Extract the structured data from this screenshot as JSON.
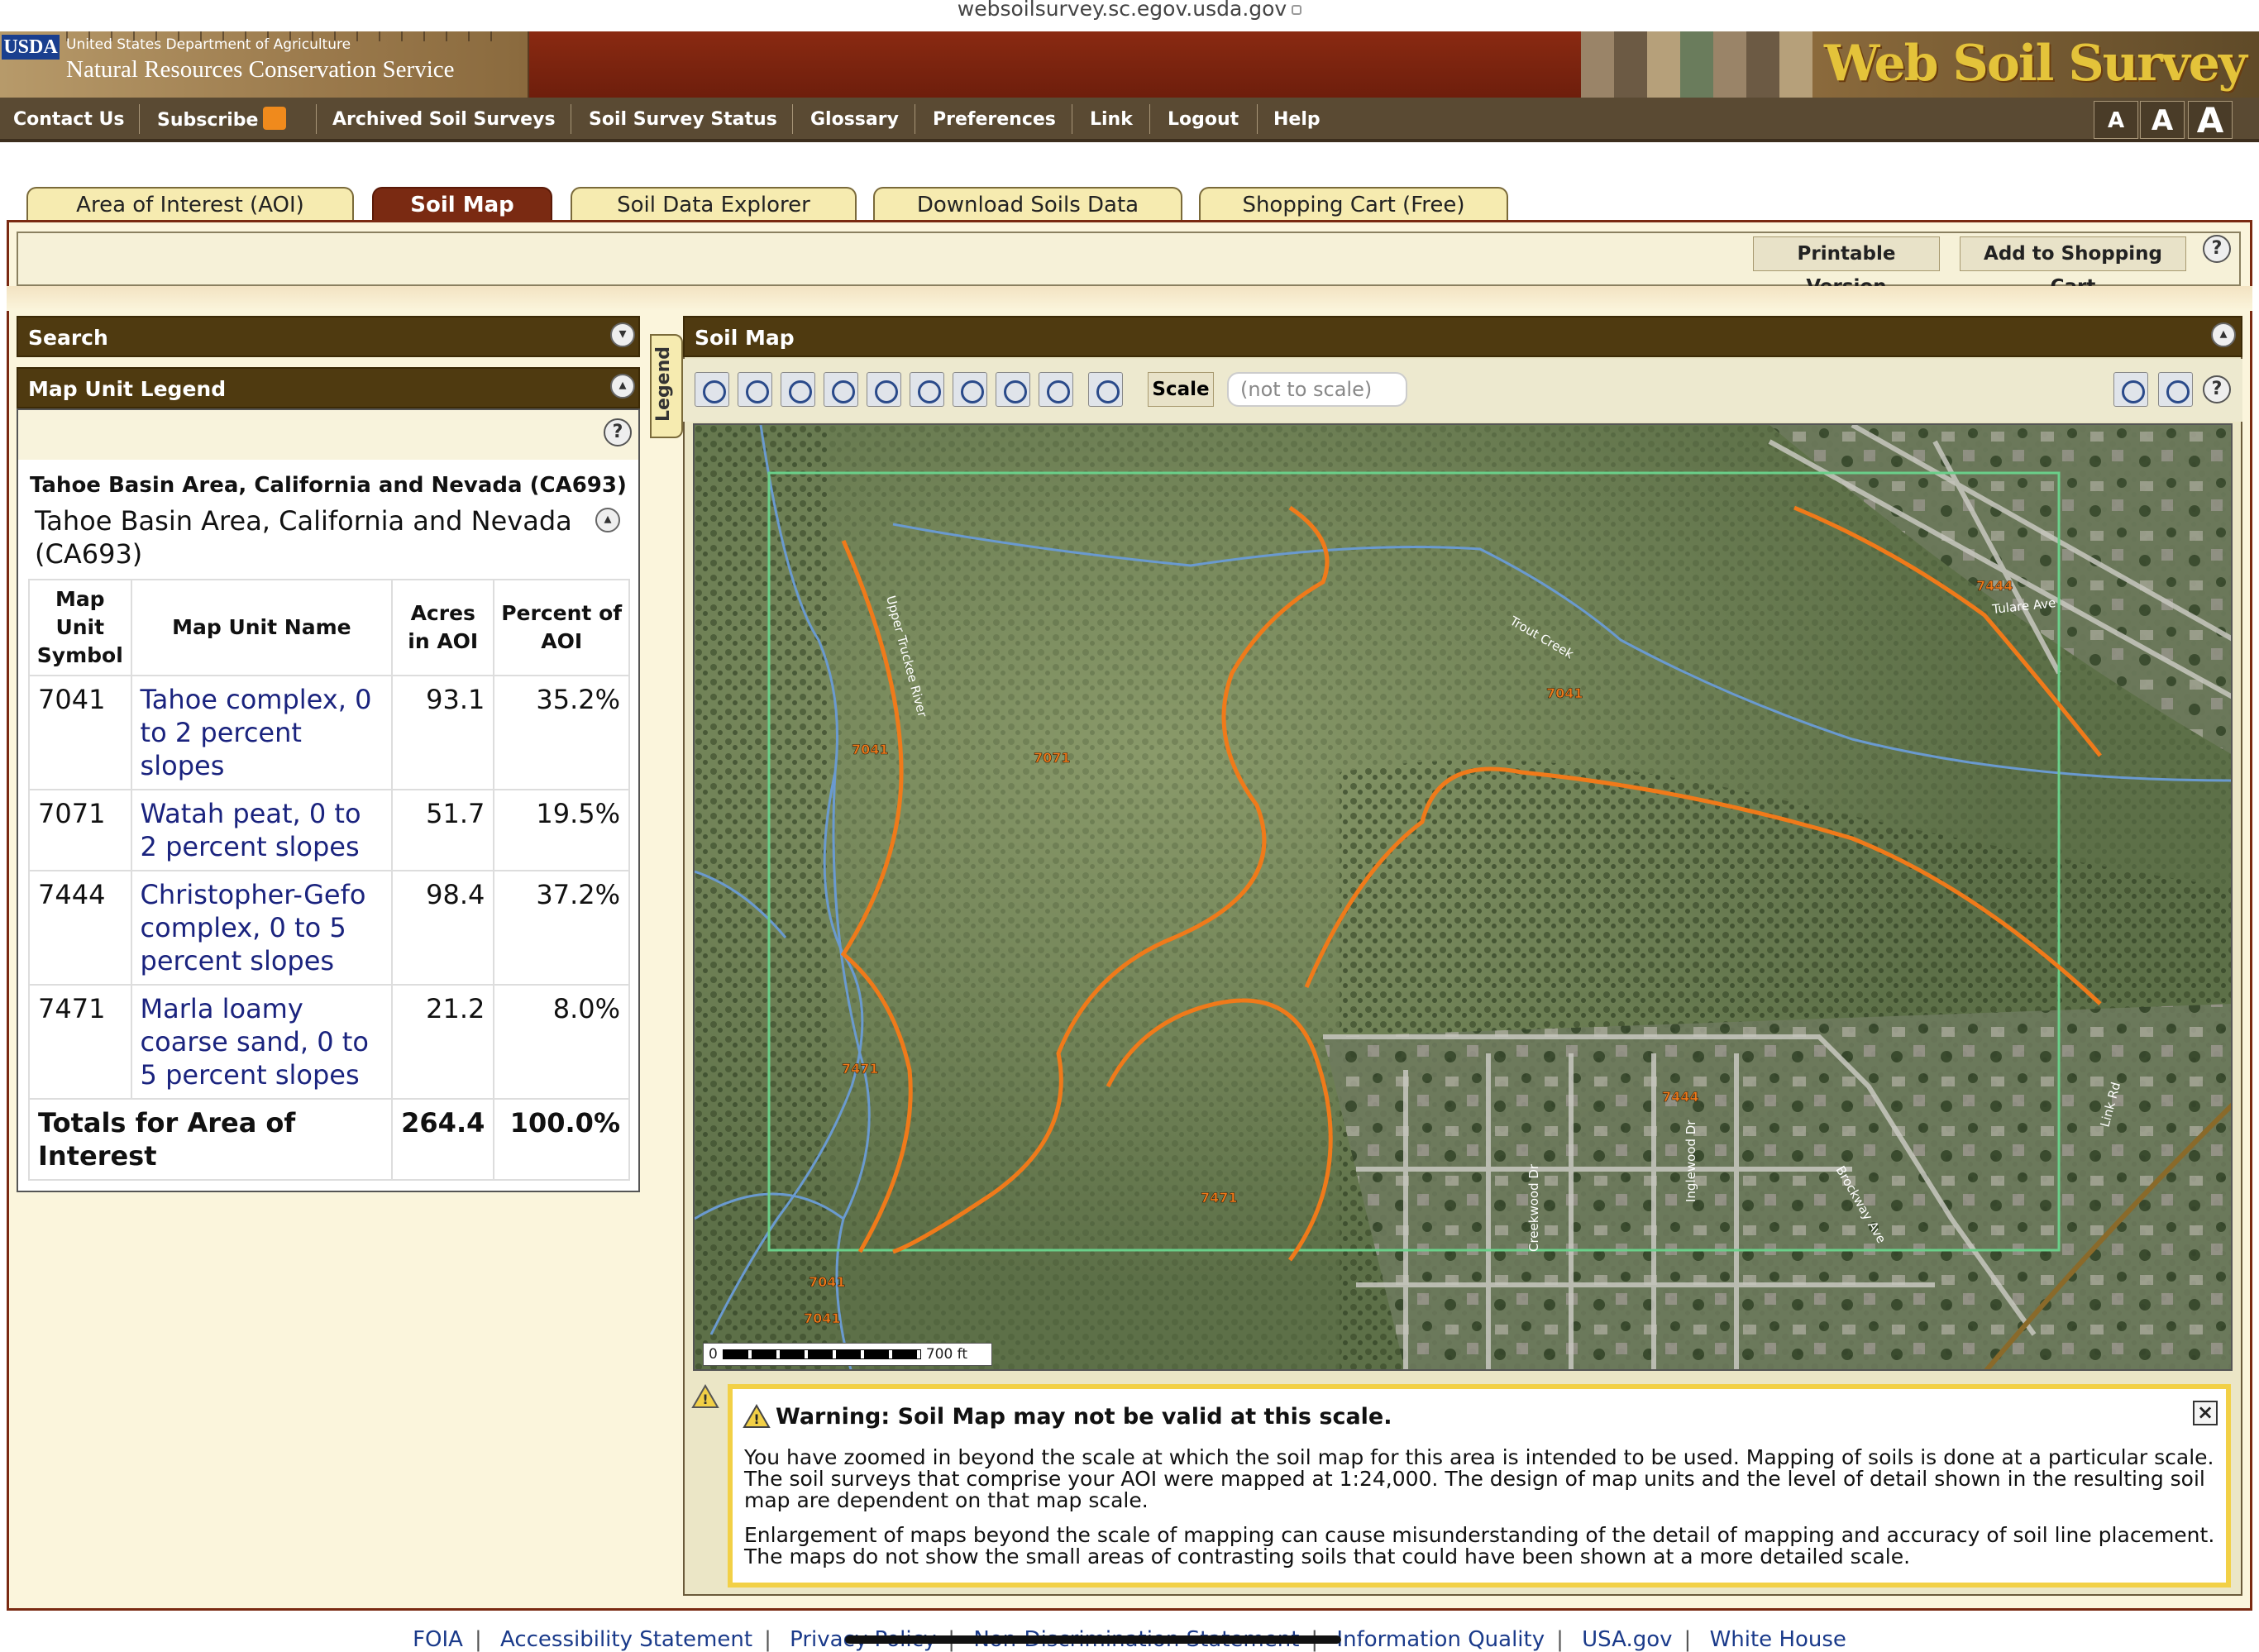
{
  "browser": {
    "url": "websoilsurvey.sc.egov.usda.gov"
  },
  "banner": {
    "usda_badge": "USDA",
    "dept": "United States Department of Agriculture",
    "agency": "Natural Resources Conservation Service",
    "app_title": "Web Soil Survey"
  },
  "topnav": {
    "items": [
      "Contact Us",
      "Subscribe",
      "Archived Soil Surveys",
      "Soil Survey Status",
      "Glossary",
      "Preferences",
      "Link",
      "Logout",
      "Help"
    ],
    "text_sizes": [
      "A",
      "A",
      "A"
    ]
  },
  "tabs": [
    {
      "label": "Area of Interest (AOI)",
      "active": false
    },
    {
      "label": "Soil Map",
      "active": true
    },
    {
      "label": "Soil Data Explorer",
      "active": false
    },
    {
      "label": "Download Soils Data",
      "active": false
    },
    {
      "label": "Shopping Cart (Free)",
      "active": false
    }
  ],
  "toolbar": {
    "printable": "Printable Version",
    "add_cart": "Add to Shopping Cart",
    "help": "?"
  },
  "left": {
    "search_title": "Search",
    "legend_title": "Map Unit Legend",
    "legend_tab": "Legend",
    "survey_heading": "Tahoe Basin Area, California and Nevada (CA693)",
    "survey_subheading": "Tahoe Basin Area, California and Nevada (CA693)",
    "columns": [
      "Map Unit Symbol",
      "Map Unit Name",
      "Acres in AOI",
      "Percent of AOI"
    ],
    "rows": [
      {
        "symbol": "7041",
        "name": "Tahoe complex, 0 to 2 percent slopes",
        "acres": "93.1",
        "percent": "35.2%"
      },
      {
        "symbol": "7071",
        "name": "Watah peat, 0 to 2 percent slopes",
        "acres": "51.7",
        "percent": "19.5%"
      },
      {
        "symbol": "7444",
        "name": "Christopher-Gefo complex, 0 to 5 percent slopes",
        "acres": "98.4",
        "percent": "37.2%"
      },
      {
        "symbol": "7471",
        "name": "Marla loamy coarse sand, 0 to 5 percent slopes",
        "acres": "21.2",
        "percent": "8.0%"
      }
    ],
    "totals": {
      "label": "Totals for Area of Interest",
      "acres": "264.4",
      "percent": "100.0%"
    }
  },
  "map": {
    "title": "Soil Map",
    "scale_label": "Scale",
    "scale_value": "(not to scale)",
    "scalebar_start": "0",
    "scalebar_end": "700 ft",
    "unit_labels": [
      "7041",
      "7071",
      "7041",
      "7444",
      "7444",
      "7471",
      "7471",
      "7041",
      "7041"
    ],
    "place_labels": [
      "Upper Truckee River",
      "Trout Creek",
      "Tulare Ave",
      "Creekwood Dr",
      "Inglewood Dr",
      "Brockway Ave",
      "Link Rd"
    ],
    "colors": {
      "soil_line": "#f07a1a",
      "stream": "#6a9ad0",
      "aoi": "#6ad08a"
    }
  },
  "warning": {
    "title": "Warning: Soil Map may not be valid at this scale.",
    "p1": "You have zoomed in beyond the scale at which the soil map for this area is intended to be used. Mapping of soils is done at a particular scale. The soil surveys that comprise your AOI were mapped at 1:24,000. The design of map units and the level of detail shown in the resulting soil map are dependent on that map scale.",
    "p2": "Enlargement of maps beyond the scale of mapping can cause misunderstanding of the detail of mapping and accuracy of soil line placement. The maps do not show the small areas of contrasting soils that could have been shown at a more detailed scale.",
    "close": "×"
  },
  "footer": {
    "links": [
      "FOIA",
      "Accessibility Statement",
      "Privacy Policy",
      "Non-Discrimination Statement",
      "Information Quality",
      "USA.gov",
      "White House"
    ]
  }
}
